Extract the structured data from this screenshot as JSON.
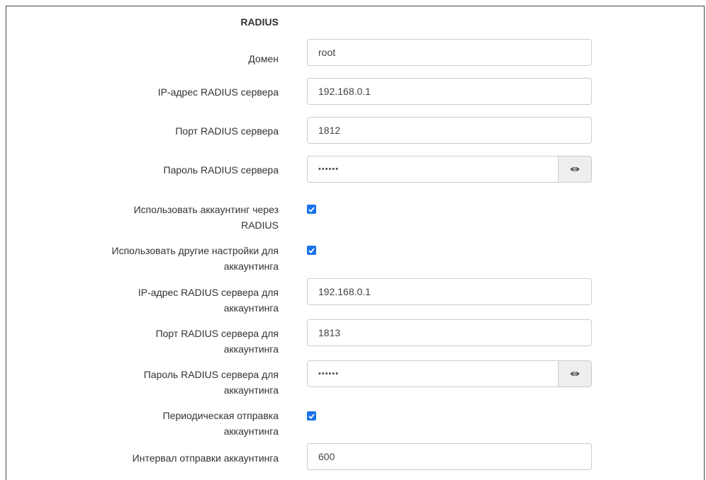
{
  "section": {
    "title": "RADIUS"
  },
  "fields": {
    "domain": {
      "label": "Домен",
      "value": "root"
    },
    "server_ip": {
      "label": "IP-адрес RADIUS сервера",
      "value": "192.168.0.1"
    },
    "server_port": {
      "label": "Порт RADIUS сервера",
      "value": "1812"
    },
    "server_password": {
      "label": "Пароль RADIUS сервера",
      "value": "••••••"
    },
    "use_accounting": {
      "label_line1": "Использовать аккаунтинг через",
      "label_line2": "RADIUS",
      "checked": true
    },
    "use_other_settings": {
      "label_line1": "Использовать другие настройки для",
      "label_line2": "аккаунтинга",
      "checked": true
    },
    "acct_server_ip": {
      "label_line1": "IP-адрес RADIUS сервера для",
      "label_line2": "аккаунтинга",
      "value": "192.168.0.1"
    },
    "acct_server_port": {
      "label_line1": "Порт RADIUS сервера для",
      "label_line2": "аккаунтинга",
      "value": "1813"
    },
    "acct_server_password": {
      "label_line1": "Пароль RADIUS сервера для",
      "label_line2": "аккаунтинга",
      "value": "••••••"
    },
    "periodic_accounting": {
      "label_line1": "Периодическая отправка",
      "label_line2": "аккаунтинга",
      "checked": true
    },
    "accounting_interval": {
      "label": "Интервал отправки аккаунтинга",
      "value": "600"
    }
  },
  "icons": {
    "show_password": "eye-icon",
    "checkbox": "checkmark-icon"
  },
  "colors": {
    "checkbox": "#1a73e8",
    "border": "#cccccc",
    "addon_bg": "#eeeeee"
  }
}
